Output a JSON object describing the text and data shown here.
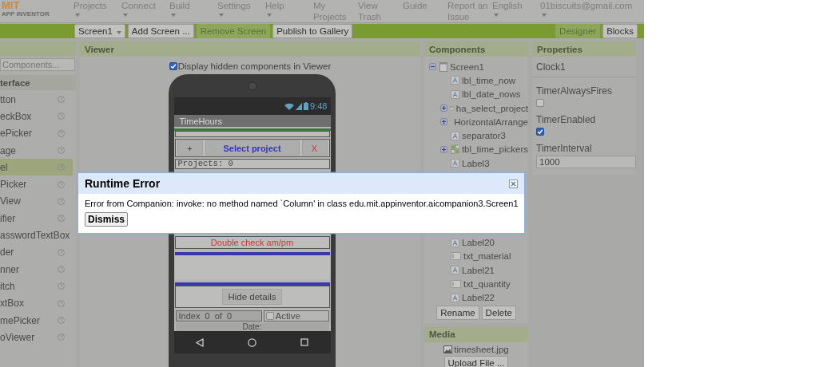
{
  "header": {
    "logo": "MIT",
    "logo_subtitle": "APP INVENTOR",
    "nav": [
      {
        "label": "Projects",
        "kind": "menu"
      },
      {
        "label": "Connect",
        "kind": "menu"
      },
      {
        "label": "Build",
        "kind": "menu"
      },
      {
        "label": "Settings",
        "kind": "menu"
      },
      {
        "label": "Help",
        "kind": "menu"
      },
      {
        "label": "My Projects",
        "kind": "link"
      },
      {
        "label": "View Trash",
        "kind": "link"
      },
      {
        "label": "Guide",
        "kind": "link"
      },
      {
        "label": "Report an Issue",
        "kind": "link"
      },
      {
        "label": "English",
        "kind": "menu"
      },
      {
        "label": "01biscuits@gmail.com",
        "kind": "menu"
      }
    ]
  },
  "toolbar": {
    "buttons": [
      {
        "label": "Screen1",
        "kind": "dropdown",
        "disabled": false
      },
      {
        "label": "Add Screen ...",
        "kind": "plain",
        "disabled": false
      },
      {
        "label": "Remove Screen",
        "kind": "plain",
        "disabled": true
      },
      {
        "label": "Publish to Gallery",
        "kind": "plain",
        "disabled": false
      }
    ],
    "views": [
      {
        "label": "Designer",
        "selected": true
      },
      {
        "label": "Blocks",
        "selected": false
      }
    ]
  },
  "palette": {
    "search": {
      "placeholder": "Components..."
    },
    "category": "terface",
    "items": [
      {
        "label": "tton",
        "selected": false
      },
      {
        "label": "eckBox",
        "selected": false
      },
      {
        "label": "ePicker",
        "selected": false
      },
      {
        "label": "age",
        "selected": false
      },
      {
        "label": "el",
        "selected": true
      },
      {
        "label": "Picker",
        "selected": false
      },
      {
        "label": "View",
        "selected": false
      },
      {
        "label": "ifier",
        "selected": false
      },
      {
        "label": "asswordTextBox",
        "selected": false
      },
      {
        "label": "der",
        "selected": false
      },
      {
        "label": "nner",
        "selected": false
      },
      {
        "label": "itch",
        "selected": false
      },
      {
        "label": "xtBox",
        "selected": false
      },
      {
        "label": "mePicker",
        "selected": false
      },
      {
        "label": "oViewer",
        "selected": false
      }
    ]
  },
  "viewer": {
    "title": "Viewer",
    "hidden_toggle": {
      "label": "Display hidden components in Viewer",
      "checked": true
    },
    "phone": {
      "time": "9:48",
      "title": "TimeHours",
      "row_buttons": [
        {
          "label": "+",
          "kind": "plain"
        },
        {
          "label": "Select project",
          "kind": "primary"
        },
        {
          "label": "X",
          "kind": "danger"
        }
      ],
      "projects_label": "Projects: 0",
      "warning": "Double check am/pm",
      "hide_button": "Hide details",
      "index_label": "Index  0  of  0",
      "active": {
        "label": "Active",
        "checked": false
      },
      "date_label": "Date:"
    }
  },
  "components": {
    "title": "Components",
    "tree": [
      {
        "label": "Screen1",
        "kind": "screen",
        "expanded": true,
        "children": [
          {
            "label": "lbl_time_now",
            "kind": "label"
          },
          {
            "label": "lbl_date_nows",
            "kind": "label"
          },
          {
            "label": "ha_select_project",
            "kind": "arrangement",
            "expanded": false
          },
          {
            "label": "HorizontalArrange",
            "kind": "arrangement",
            "expanded": false
          },
          {
            "label": "separator3",
            "kind": "label"
          },
          {
            "label": "tbl_time_pickers",
            "kind": "table",
            "expanded": false
          },
          {
            "label": "Label3",
            "kind": "label"
          },
          {
            "label": "Label20",
            "kind": "label",
            "after_dialog": true
          },
          {
            "label": "txt_material",
            "kind": "textbox"
          },
          {
            "label": "Label21",
            "kind": "label"
          },
          {
            "label": "txt_quantity",
            "kind": "textbox"
          },
          {
            "label": "Label22",
            "kind": "label"
          }
        ]
      }
    ],
    "buttons": [
      "Rename",
      "Delete"
    ]
  },
  "media": {
    "title": "Media",
    "files": [
      "timesheet.jpg"
    ],
    "upload_button": "Upload File ..."
  },
  "properties": {
    "title": "Properties",
    "component": "Clock1",
    "fields": [
      {
        "label": "TimerAlwaysFires",
        "kind": "checkbox",
        "checked": false
      },
      {
        "label": "TimerEnabled",
        "kind": "checkbox",
        "checked": true
      },
      {
        "label": "TimerInterval",
        "kind": "text",
        "value": "1000"
      }
    ]
  },
  "dialog": {
    "title": "Runtime Error",
    "message": "Error from Companion: invoke: no method named `Column' in class edu.mit.appinventor.aicompanion3.Screen1",
    "button": "Dismiss"
  }
}
